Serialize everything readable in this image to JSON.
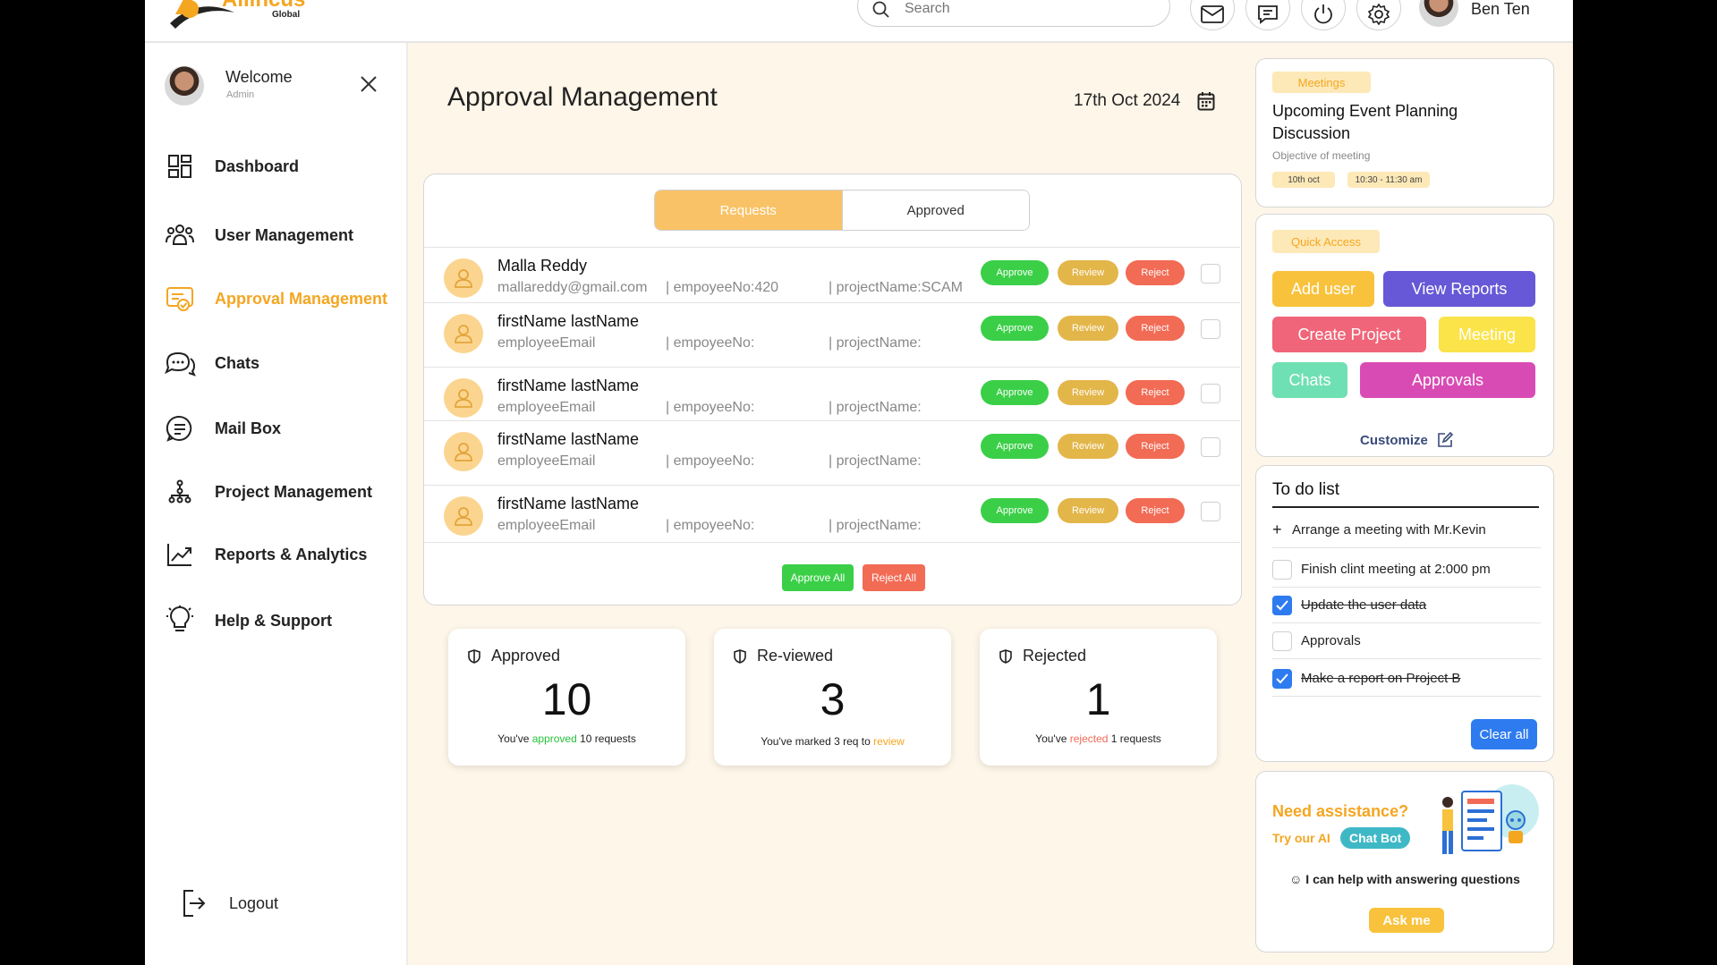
{
  "header": {
    "logo_text": "Allincus",
    "logo_sub": "Global",
    "search_placeholder": "Search",
    "user_name": "Ben Ten"
  },
  "sidebar": {
    "welcome": "Welcome",
    "role": "Admin",
    "items": [
      {
        "label": "Dashboard",
        "icon": "dashboard-icon"
      },
      {
        "label": "User Management",
        "icon": "users-icon"
      },
      {
        "label": "Approval Management",
        "icon": "approval-icon",
        "active": true
      },
      {
        "label": "Chats",
        "icon": "chats-icon"
      },
      {
        "label": "Mail Box",
        "icon": "mailbox-icon"
      },
      {
        "label": "Project Management",
        "icon": "project-icon"
      },
      {
        "label": "Reports & Analytics",
        "icon": "analytics-icon"
      },
      {
        "label": "Help & Support",
        "icon": "help-icon"
      }
    ],
    "logout": "Logout"
  },
  "main": {
    "title": "Approval Management",
    "date": "17th Oct 2024",
    "tabs": [
      "Requests",
      "Approved"
    ],
    "requests": [
      {
        "name": "Malla Reddy",
        "email": "mallareddy@gmail.com",
        "emp": "| empoyeeNo:420",
        "project": "| projectName:SCAM"
      },
      {
        "name": "firstName lastName",
        "email": "employeeEmail",
        "emp": "| empoyeeNo:",
        "project": "| projectName:"
      },
      {
        "name": "firstName lastName",
        "email": "employeeEmail",
        "emp": "| empoyeeNo:",
        "project": "| projectName:"
      },
      {
        "name": "firstName lastName",
        "email": "employeeEmail",
        "emp": "| empoyeeNo:",
        "project": "| projectName:"
      },
      {
        "name": "firstName lastName",
        "email": "employeeEmail",
        "emp": "| empoyeeNo:",
        "project": "| projectName:"
      }
    ],
    "actions": {
      "approve": "Approve",
      "review": "Review",
      "reject": "Reject"
    },
    "approve_all": "Approve All",
    "reject_all": "Reject All",
    "stats": [
      {
        "title": "Approved",
        "count": "10",
        "pre": "You've ",
        "hl": "approved",
        "post": " 10 requests",
        "hl_color": "#27c23a"
      },
      {
        "title": "Re-viewed",
        "count": "3",
        "pre": "You've marked 3 req to ",
        "hl": "review",
        "post": "",
        "hl_color": "#f4a621"
      },
      {
        "title": "Rejected",
        "count": "1",
        "pre": "You've ",
        "hl": "rejected",
        "post": " 1 requests",
        "hl_color": "#f26b55"
      }
    ]
  },
  "meeting": {
    "tag": "Meetings",
    "title": "Upcoming Event Planning Discussion",
    "objective": "Objective of meeting",
    "date": "10th oct",
    "time": "10:30 - 11:30 am"
  },
  "quick_access": {
    "tag": "Quick Access",
    "buttons": [
      {
        "label": "Add user",
        "color": "#f9c23c"
      },
      {
        "label": "View Reports",
        "color": "#6658d6"
      },
      {
        "label": "Create Project",
        "color": "#f06579"
      },
      {
        "label": "Meeting",
        "color": "#fbe34a"
      },
      {
        "label": "Chats",
        "color": "#6fe0b4"
      },
      {
        "label": "Approvals",
        "color": "#d94bb4"
      }
    ],
    "customize": "Customize"
  },
  "todo": {
    "title": "To do list",
    "add": "Arrange a meeting with Mr.Kevin",
    "items": [
      {
        "text": "Finish clint meeting at 2:000 pm",
        "done": false
      },
      {
        "text": "Update the user data ",
        "done": true
      },
      {
        "text": "Approvals",
        "done": false
      },
      {
        "text": "Make a report on Project B ",
        "done": true
      }
    ],
    "clear": "Clear all"
  },
  "assist": {
    "heading": "Need assistance?",
    "try": "Try our AI",
    "bot": "Chat Bot",
    "help": "I can help with answering questions",
    "ask": "Ask me"
  }
}
